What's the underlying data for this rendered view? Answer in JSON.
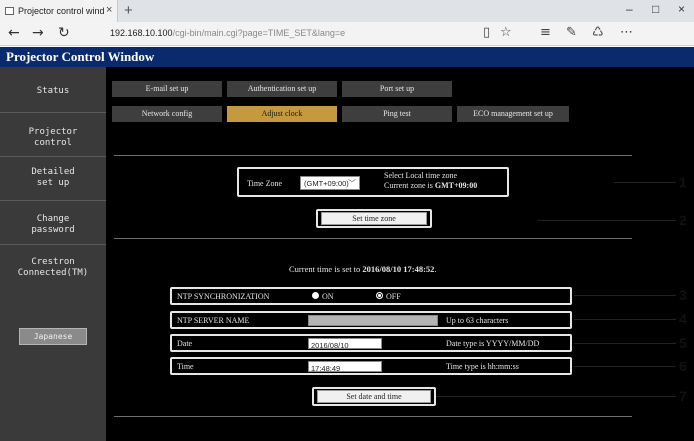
{
  "browser": {
    "tab_title": "Projector control window",
    "tab_close": "×",
    "new_tab": "+",
    "url_host": "192.168.10.100",
    "url_path": "/cgi-bin/main.cgi?page=TIME_SET&lang=e",
    "back": "←",
    "forward": "→",
    "refresh": "↻",
    "window_controls": [
      "–",
      "□",
      "×"
    ]
  },
  "app": {
    "title": "Projector Control Window"
  },
  "sidebar": {
    "items": [
      {
        "label": "Status"
      },
      {
        "label": "Projector control"
      },
      {
        "label": "Detailed set up"
      },
      {
        "label": "Change password"
      },
      {
        "label": "Crestron Connected(TM)"
      }
    ],
    "language_button": "Japanese"
  },
  "tabs": {
    "row1": [
      "E-mail set up",
      "Authentication set up",
      "Port set up"
    ],
    "row2": [
      "Network config",
      "Adjust clock",
      "Ping test",
      "ECO management set up"
    ],
    "active": "Adjust clock"
  },
  "timezone": {
    "label": "Time Zone",
    "value": "(GMT+09:00)",
    "hint_line1": "Select Local time zone",
    "hint_line2_prefix": "Current zone is ",
    "hint_line2_value": "GMT+09:00",
    "button": "Set time zone"
  },
  "current_time": {
    "prefix": "Current time is set to ",
    "value": "2016/08/10 17:48:52",
    "suffix": "."
  },
  "form": {
    "ntp_sync_label": "NTP SYNCHRONIZATION",
    "ntp_on": "ON",
    "ntp_off": "OFF",
    "ntp_selected": "OFF",
    "ntp_server_label": "NTP SERVER NAME",
    "ntp_server_value": "",
    "ntp_server_hint": "Up to 63 characters",
    "date_label": "Date",
    "date_value": "2016/08/10",
    "date_hint": "Date type is YYYY/MM/DD",
    "time_label": "Time",
    "time_value": "17:48:49",
    "time_hint": "Time type is hh:mm:ss",
    "button": "Set date and time"
  },
  "callouts": [
    "1",
    "2",
    "3",
    "4",
    "5",
    "6",
    "7"
  ]
}
